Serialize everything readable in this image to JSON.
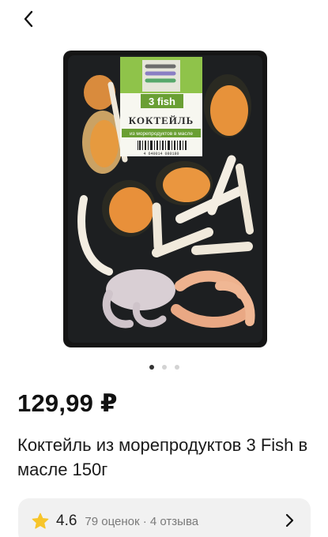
{
  "header": {
    "back_icon": "chevron-left-icon"
  },
  "gallery": {
    "slides_count": 3,
    "active_index": 0,
    "package": {
      "brand": "3 fish",
      "label_title": "КОКТЕЙЛЬ",
      "label_subtitle": "из морепродуктов в масле",
      "barcode_digits": "4 640014 080180"
    }
  },
  "product": {
    "price": "129,99 ₽",
    "title": "Коктейль из морепродуктов 3 Fish в масле 150г"
  },
  "rating": {
    "value": "4.6",
    "meta": "79 оценок · 4 отзыва",
    "star_icon": "star-icon",
    "chevron_icon": "chevron-right-icon",
    "star_color": "#f7c52b"
  }
}
